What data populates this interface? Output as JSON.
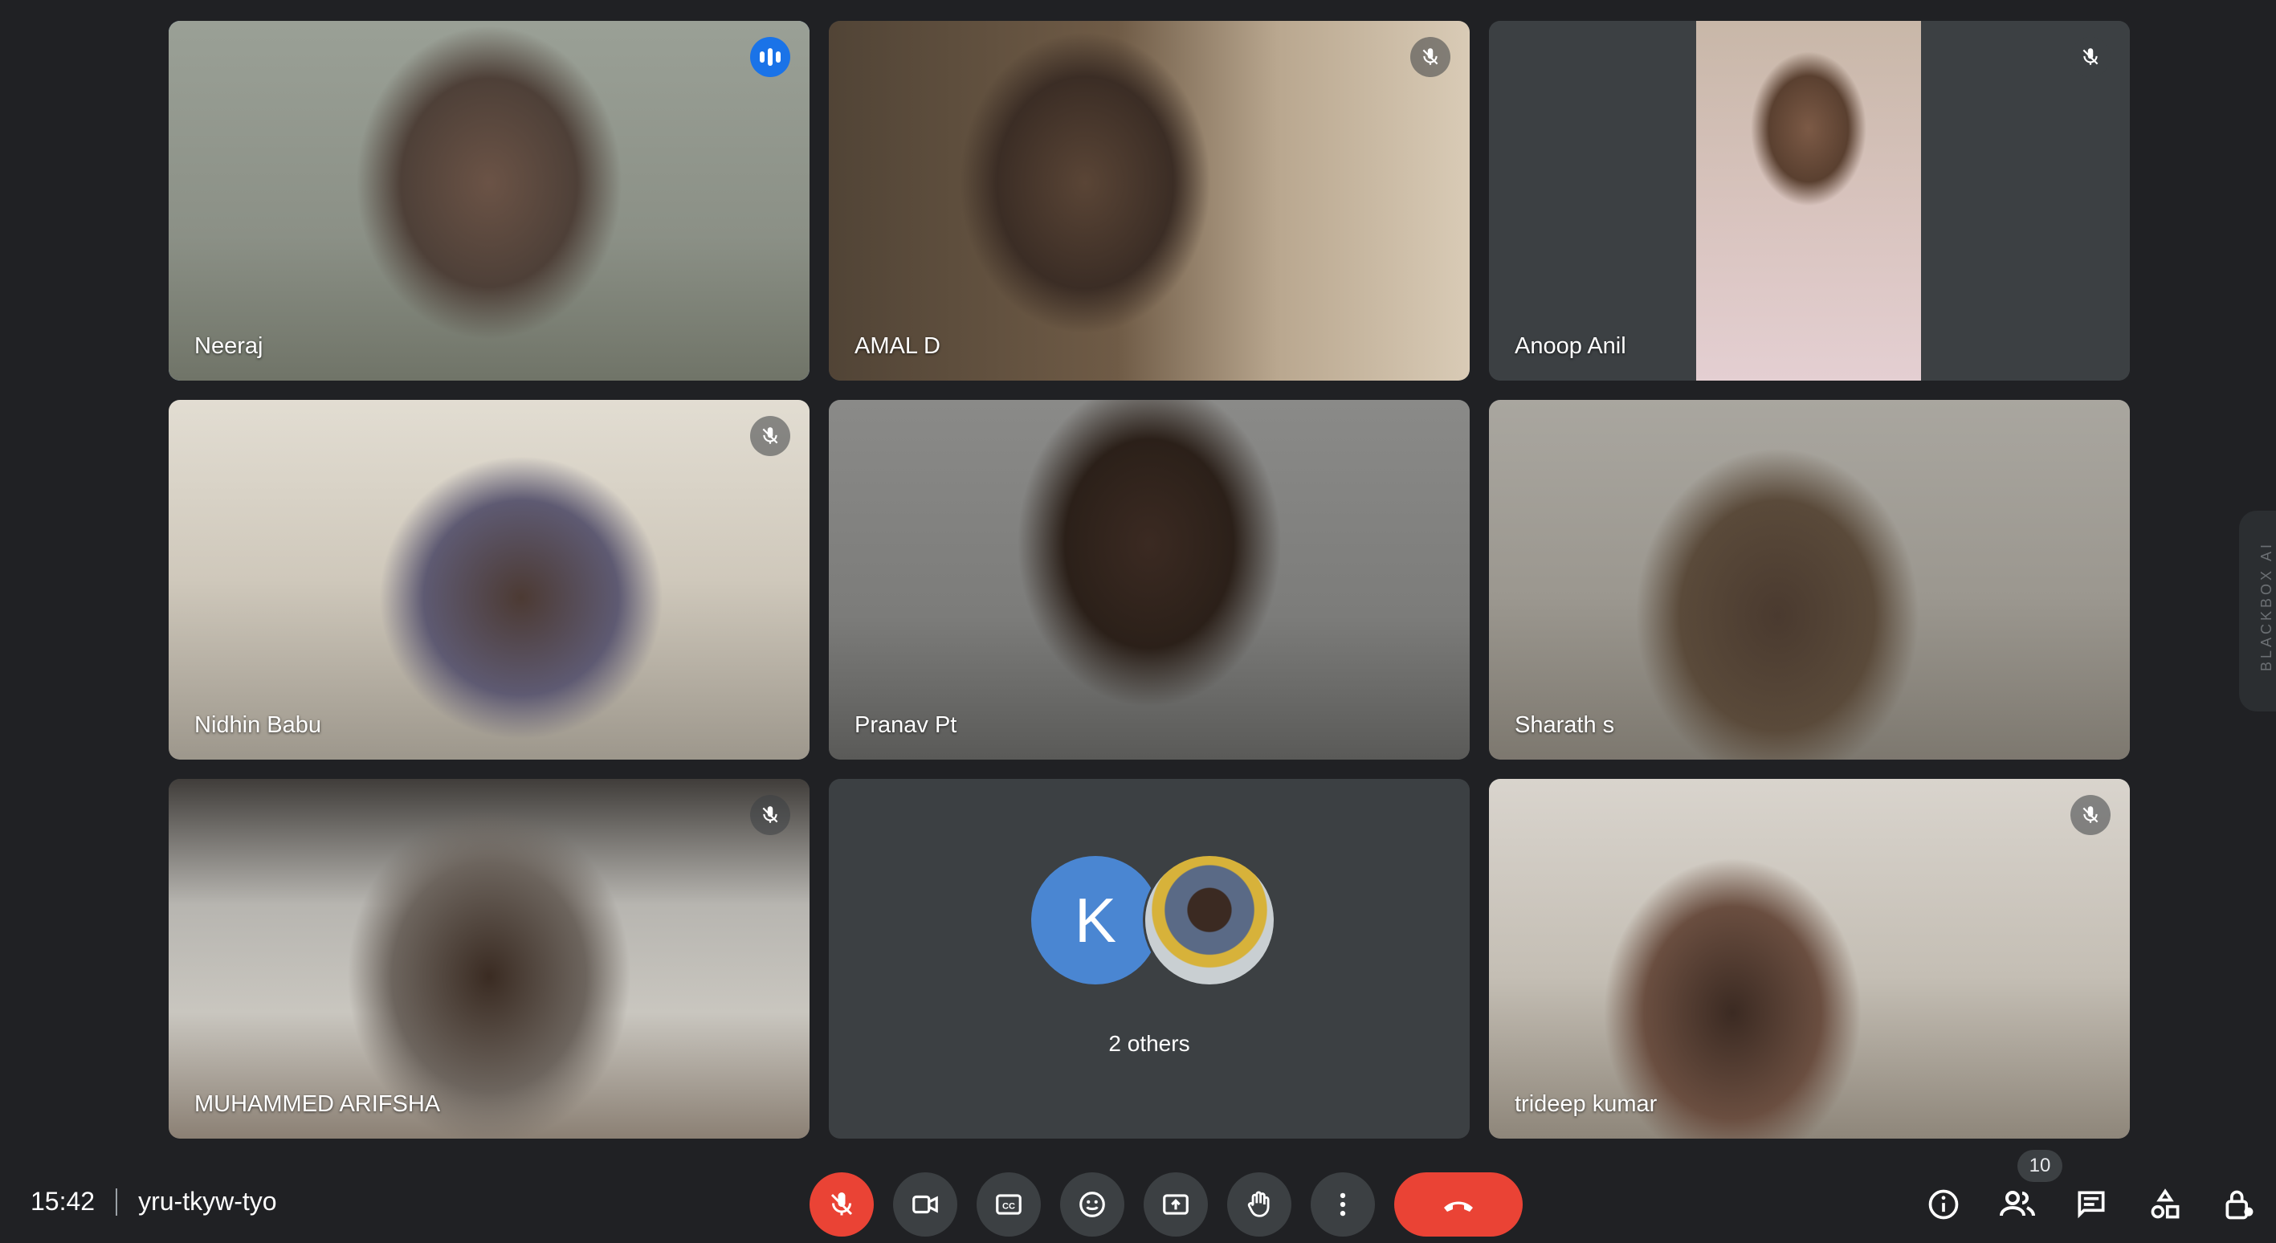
{
  "participants": [
    {
      "name": "Neeraj",
      "status": "speaking"
    },
    {
      "name": "AMAL D",
      "status": "muted"
    },
    {
      "name": "Anoop Anil",
      "status": "muted"
    },
    {
      "name": "Nidhin Babu",
      "status": "muted"
    },
    {
      "name": "Pranav Pt",
      "status": "unmuted"
    },
    {
      "name": "Sharath s",
      "status": "unmuted"
    },
    {
      "name": "MUHAMMED ARIFSHA",
      "status": "muted"
    },
    {
      "name": "trideep kumar",
      "status": "muted"
    }
  ],
  "others_tile": {
    "avatar_initial": "K",
    "label": "2 others"
  },
  "meeting": {
    "time": "15:42",
    "code": "yru-tkyw-tyo"
  },
  "people_count": "10",
  "side_extension": {
    "label": "BLACKBOX AI"
  },
  "controls": [
    "mic-off",
    "camera",
    "captions",
    "emoji",
    "present",
    "raise-hand",
    "more",
    "leave-call"
  ],
  "right_controls": [
    "meeting-info",
    "people",
    "chat",
    "activities",
    "host-controls"
  ],
  "colors": {
    "background": "#202124",
    "tile": "#3c4043",
    "accent": "#8ab4f8",
    "danger": "#ea4335",
    "avatar_k": "#4a86d2"
  }
}
